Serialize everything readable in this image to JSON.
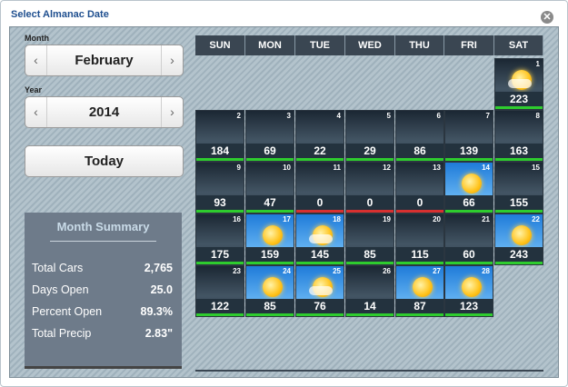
{
  "dialog": {
    "title": "Select Almanac Date",
    "close_glyph": "✕"
  },
  "month_selector": {
    "label": "Month",
    "value": "February",
    "prev_glyph": "‹",
    "next_glyph": "›"
  },
  "year_selector": {
    "label": "Year",
    "value": "2014",
    "prev_glyph": "‹",
    "next_glyph": "›"
  },
  "today_button": {
    "label": "Today"
  },
  "summary": {
    "heading": "Month Summary",
    "rows": [
      {
        "label": "Total Cars",
        "value": "2,765"
      },
      {
        "label": "Days Open",
        "value": "25.0"
      },
      {
        "label": "Percent Open",
        "value": "89.3%"
      },
      {
        "label": "Total Precip",
        "value": "2.83\""
      }
    ]
  },
  "calendar": {
    "weekdays": [
      "SUN",
      "MON",
      "TUE",
      "WED",
      "THU",
      "FRI",
      "SAT"
    ],
    "colors": {
      "open": "#2ecc2e",
      "closed": "#d83030"
    },
    "days": [
      {
        "day": "1",
        "count": "223",
        "weather": "sun-cloud",
        "status": "open"
      },
      {
        "day": "2",
        "count": "184",
        "weather": "night",
        "status": "open"
      },
      {
        "day": "3",
        "count": "69",
        "weather": "night",
        "status": "open"
      },
      {
        "day": "4",
        "count": "22",
        "weather": "night",
        "status": "open"
      },
      {
        "day": "5",
        "count": "29",
        "weather": "night",
        "status": "open"
      },
      {
        "day": "6",
        "count": "86",
        "weather": "night",
        "status": "open"
      },
      {
        "day": "7",
        "count": "139",
        "weather": "night",
        "status": "open"
      },
      {
        "day": "8",
        "count": "163",
        "weather": "night",
        "status": "open"
      },
      {
        "day": "9",
        "count": "93",
        "weather": "night",
        "status": "open"
      },
      {
        "day": "10",
        "count": "47",
        "weather": "night",
        "status": "open"
      },
      {
        "day": "11",
        "count": "0",
        "weather": "night",
        "status": "closed"
      },
      {
        "day": "12",
        "count": "0",
        "weather": "night",
        "status": "closed"
      },
      {
        "day": "13",
        "count": "0",
        "weather": "night",
        "status": "closed"
      },
      {
        "day": "14",
        "count": "66",
        "weather": "sun",
        "status": "open"
      },
      {
        "day": "15",
        "count": "155",
        "weather": "night",
        "status": "open"
      },
      {
        "day": "16",
        "count": "175",
        "weather": "night",
        "status": "open"
      },
      {
        "day": "17",
        "count": "159",
        "weather": "sun",
        "status": "open"
      },
      {
        "day": "18",
        "count": "145",
        "weather": "sun-cloud",
        "status": "open"
      },
      {
        "day": "19",
        "count": "85",
        "weather": "night",
        "status": "open"
      },
      {
        "day": "20",
        "count": "115",
        "weather": "night",
        "status": "open"
      },
      {
        "day": "21",
        "count": "60",
        "weather": "night",
        "status": "open"
      },
      {
        "day": "22",
        "count": "243",
        "weather": "sun",
        "status": "open"
      },
      {
        "day": "23",
        "count": "122",
        "weather": "night",
        "status": "open"
      },
      {
        "day": "24",
        "count": "85",
        "weather": "sun",
        "status": "open"
      },
      {
        "day": "25",
        "count": "76",
        "weather": "sun-cloud",
        "status": "open"
      },
      {
        "day": "26",
        "count": "14",
        "weather": "night",
        "status": "open"
      },
      {
        "day": "27",
        "count": "87",
        "weather": "sun",
        "status": "open"
      },
      {
        "day": "28",
        "count": "123",
        "weather": "sun",
        "status": "open"
      }
    ]
  }
}
